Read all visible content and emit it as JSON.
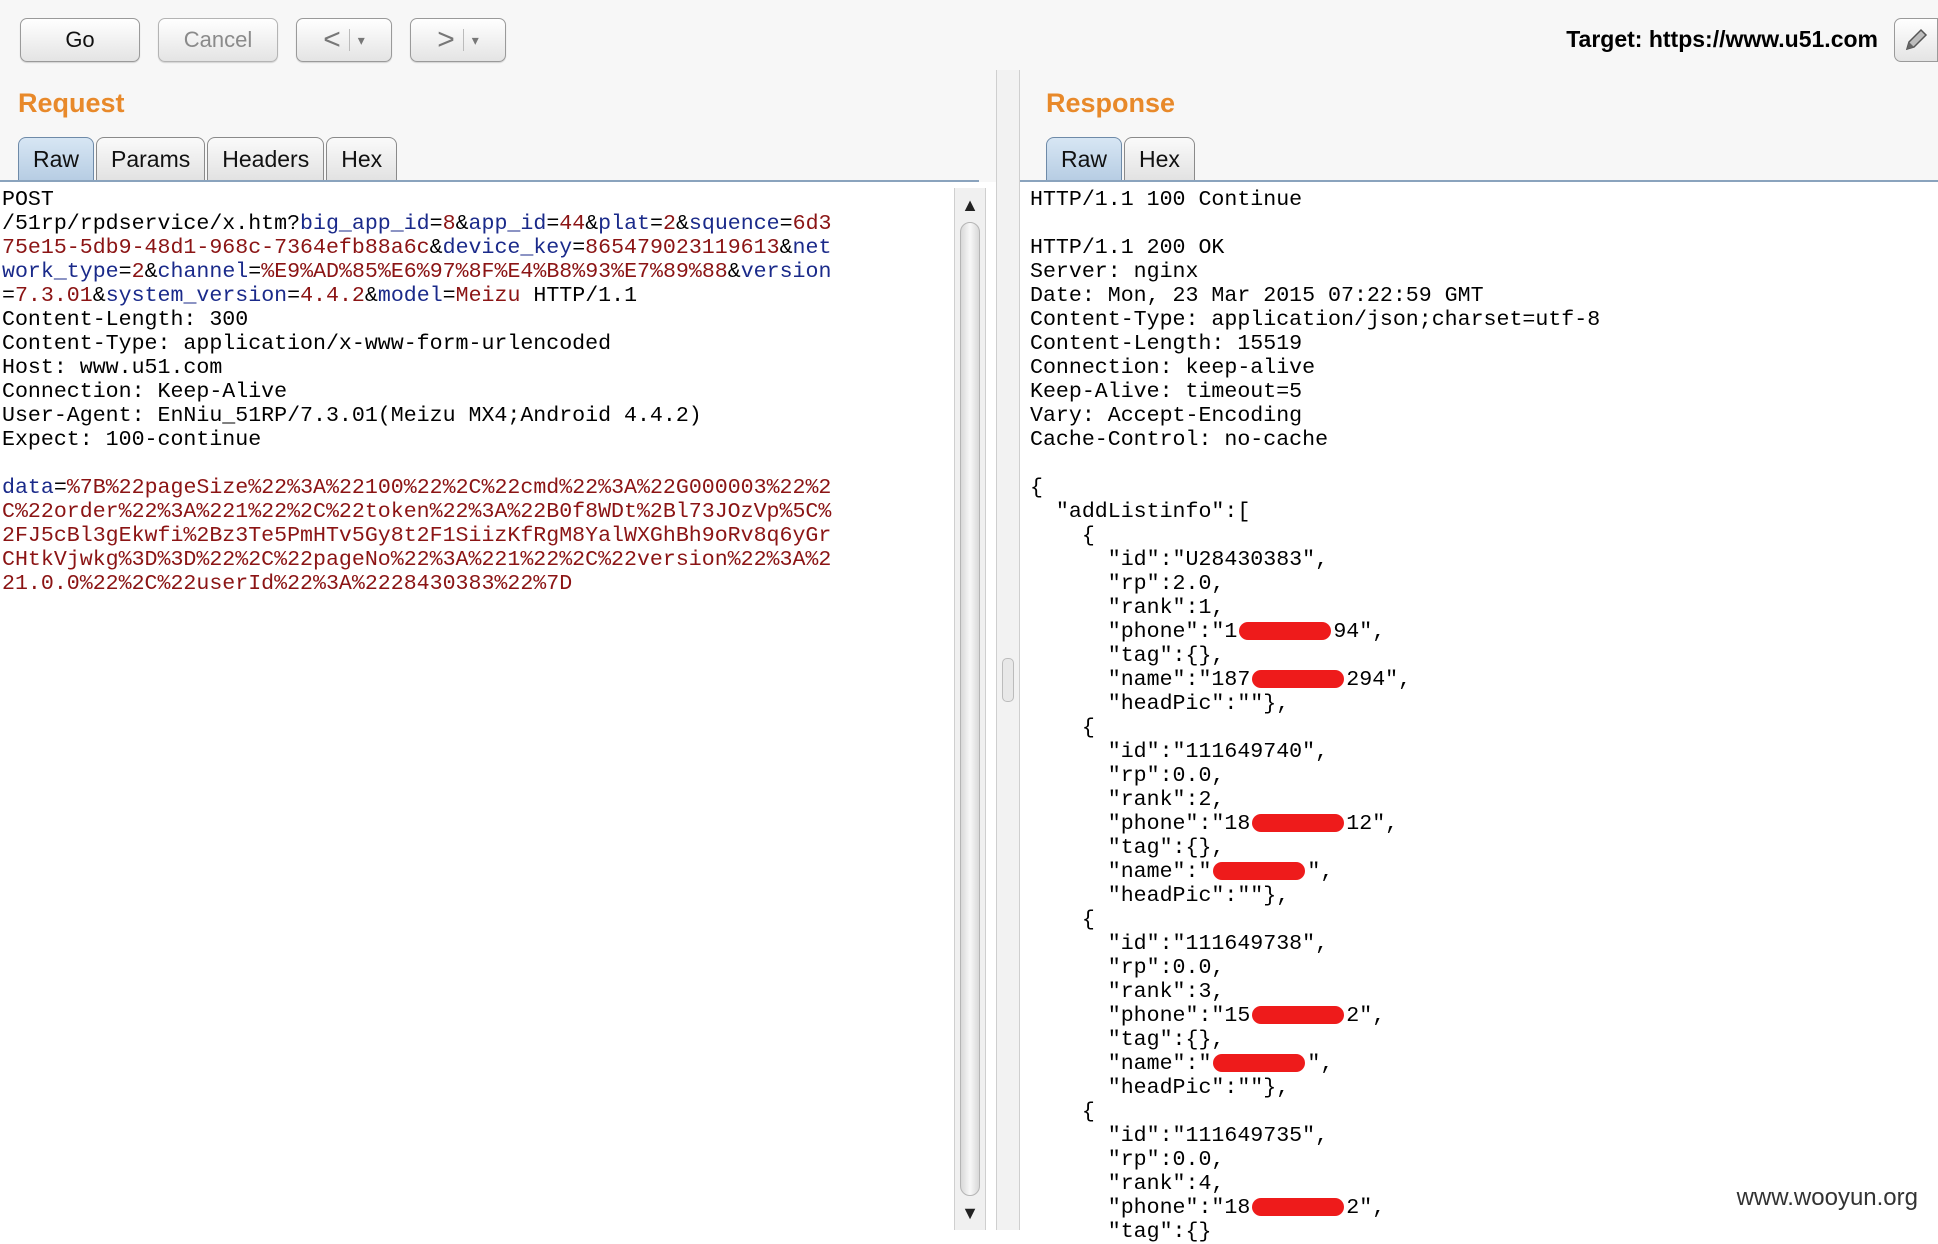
{
  "toolbar": {
    "go_label": "Go",
    "cancel_label": "Cancel",
    "back_glyph": "<",
    "forward_glyph": ">",
    "dropdown_glyph": "▾",
    "target_label": "Target: https://www.u51.com",
    "edit_icon": "pencil-icon"
  },
  "request": {
    "title": "Request",
    "tabs": [
      "Raw",
      "Params",
      "Headers",
      "Hex"
    ],
    "active_tab": "Raw",
    "method": "POST",
    "path": "/51rp/rpdservice/x.htm?",
    "query": [
      {
        "k": "big_app_id",
        "v": "8"
      },
      {
        "k": "app_id",
        "v": "44"
      },
      {
        "k": "plat",
        "v": "2"
      },
      {
        "k": "squence",
        "v": "6d375e15-5db9-48d1-968c-7364efb88a6c"
      },
      {
        "k": "device_key",
        "v": "865479023119613"
      },
      {
        "k": "network_type",
        "v": "2"
      },
      {
        "k": "channel",
        "v": "%E9%AD%85%E6%97%8F%E4%B8%93%E7%89%88"
      },
      {
        "k": "version",
        "v": "7.3.01"
      },
      {
        "k": "system_version",
        "v": "4.4.2"
      },
      {
        "k": "model",
        "v": "Meizu"
      }
    ],
    "protocol": " HTTP/1.1",
    "headers": [
      "Content-Length: 300",
      "Content-Type: application/x-www-form-urlencoded",
      "Host: www.u51.com",
      "Connection: Keep-Alive",
      "User-Agent: EnNiu_51RP/7.3.01(Meizu MX4;Android 4.4.2)",
      "Expect: 100-continue"
    ],
    "body_key": "data",
    "body_value": "%7B%22pageSize%22%3A%22100%22%2C%22cmd%22%3A%22G000003%22%2C%22order%22%3A%221%22%2C%22token%22%3A%22B0f8WDt%2Bl73JOzVp%5C%2FJ5cBl3gEkwfi%2Bz3Te5PmHTv5Gy8t2F1SiizKfRgM8YalWXGhBh9oRv8q6yGrCHtkVjwkg%3D%3D%22%2C%22pageNo%22%3A%221%22%2C%22version%22%3A%221.0.0%22%2C%22userId%22%3A%2228430383%22%7D"
  },
  "response": {
    "title": "Response",
    "tabs": [
      "Raw",
      "Hex"
    ],
    "active_tab": "Raw",
    "lines": [
      "HTTP/1.1 100 Continue",
      "",
      "HTTP/1.1 200 OK",
      "Server: nginx",
      "Date: Mon, 23 Mar 2015 07:22:59 GMT",
      "Content-Type: application/json;charset=utf-8",
      "Content-Length: 15519",
      "Connection: keep-alive",
      "Keep-Alive: timeout=5",
      "Vary: Accept-Encoding",
      "Cache-Control: no-cache",
      "",
      "{",
      "  \"addListinfo\":[",
      "    {",
      "      \"id\":\"U28430383\",",
      "      \"rp\":2.0,",
      "      \"rank\":1,",
      "      \"phone\":\"1[R]94\",",
      "      \"tag\":{},",
      "      \"name\":\"187[R]294\",",
      "      \"headPic\":\"\"},",
      "    {",
      "      \"id\":\"111649740\",",
      "      \"rp\":0.0,",
      "      \"rank\":2,",
      "      \"phone\":\"18[R]12\",",
      "      \"tag\":{},",
      "      \"name\":\"[R]\",",
      "      \"headPic\":\"\"},",
      "    {",
      "      \"id\":\"111649738\",",
      "      \"rp\":0.0,",
      "      \"rank\":3,",
      "      \"phone\":\"15[R]2\",",
      "      \"tag\":{},",
      "      \"name\":\"[R]\",",
      "      \"headPic\":\"\"},",
      "    {",
      "      \"id\":\"111649735\",",
      "      \"rp\":0.0,",
      "      \"rank\":4,",
      "      \"phone\":\"18[R]2\",",
      "      \"tag\":{}"
    ]
  },
  "watermark": "www.wooyun.org",
  "colors": {
    "title": "#e8892a",
    "param_key": "#1a2a8a",
    "param_value": "#8b1414",
    "redaction": "#ee1b1b",
    "active_tab": "#c5d9ec"
  }
}
